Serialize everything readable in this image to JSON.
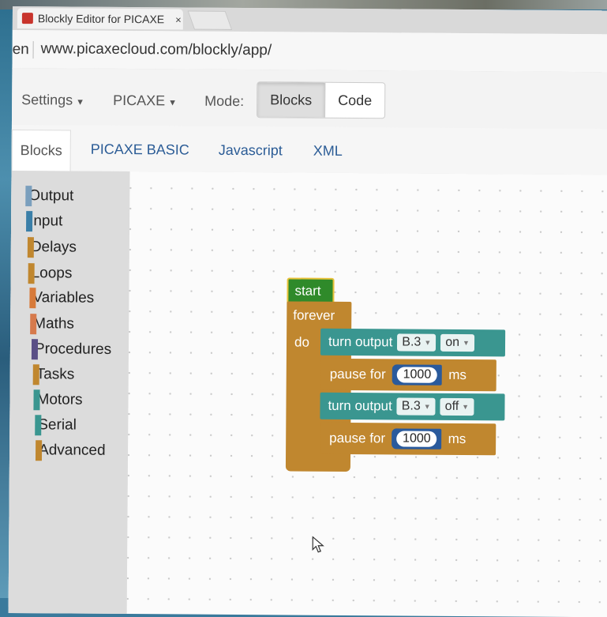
{
  "browser": {
    "tab_title": "Blockly Editor for PICAXE",
    "tab_close": "×",
    "address_prefix": "en",
    "url": "www.picaxecloud.com/blockly/app/"
  },
  "toolbar": {
    "settings_label": "Settings",
    "picaxe_label": "PICAXE",
    "mode_label": "Mode:",
    "mode_buttons": [
      {
        "label": "Blocks",
        "active": true
      },
      {
        "label": "Code",
        "active": false
      }
    ]
  },
  "code_tabs": [
    {
      "label": "Blocks",
      "active": true
    },
    {
      "label": "PICAXE BASIC",
      "active": false
    },
    {
      "label": "Javascript",
      "active": false
    },
    {
      "label": "XML",
      "active": false
    }
  ],
  "categories": [
    {
      "label": "Output",
      "color": "#7a9fbd"
    },
    {
      "label": "Input",
      "color": "#3a7fa8"
    },
    {
      "label": "Delays",
      "color": "#c0872f"
    },
    {
      "label": "Loops",
      "color": "#c0872f"
    },
    {
      "label": "Variables",
      "color": "#d77a3a"
    },
    {
      "label": "Maths",
      "color": "#d67a4c"
    },
    {
      "label": "Procedures",
      "color": "#5a4f86"
    },
    {
      "label": "Tasks",
      "color": "#c0872f"
    },
    {
      "label": "Motors",
      "color": "#3a9690"
    },
    {
      "label": "Serial",
      "color": "#3a9690"
    },
    {
      "label": "Advanced",
      "color": "#c0872f"
    }
  ],
  "blocks": {
    "start": "start",
    "forever": "forever",
    "do": "do",
    "output1": {
      "label": "turn output",
      "pin": "B.3",
      "state": "on"
    },
    "pause1": {
      "label": "pause for",
      "value": "1000",
      "unit": "ms"
    },
    "output2": {
      "label": "turn output",
      "pin": "B.3",
      "state": "off"
    },
    "pause2": {
      "label": "pause for",
      "value": "1000",
      "unit": "ms"
    }
  },
  "colors": {
    "start_block": "#2f8a2a",
    "loop_block": "#c0872f",
    "output_block": "#3a9690",
    "number_socket": "#2a5a9c"
  }
}
